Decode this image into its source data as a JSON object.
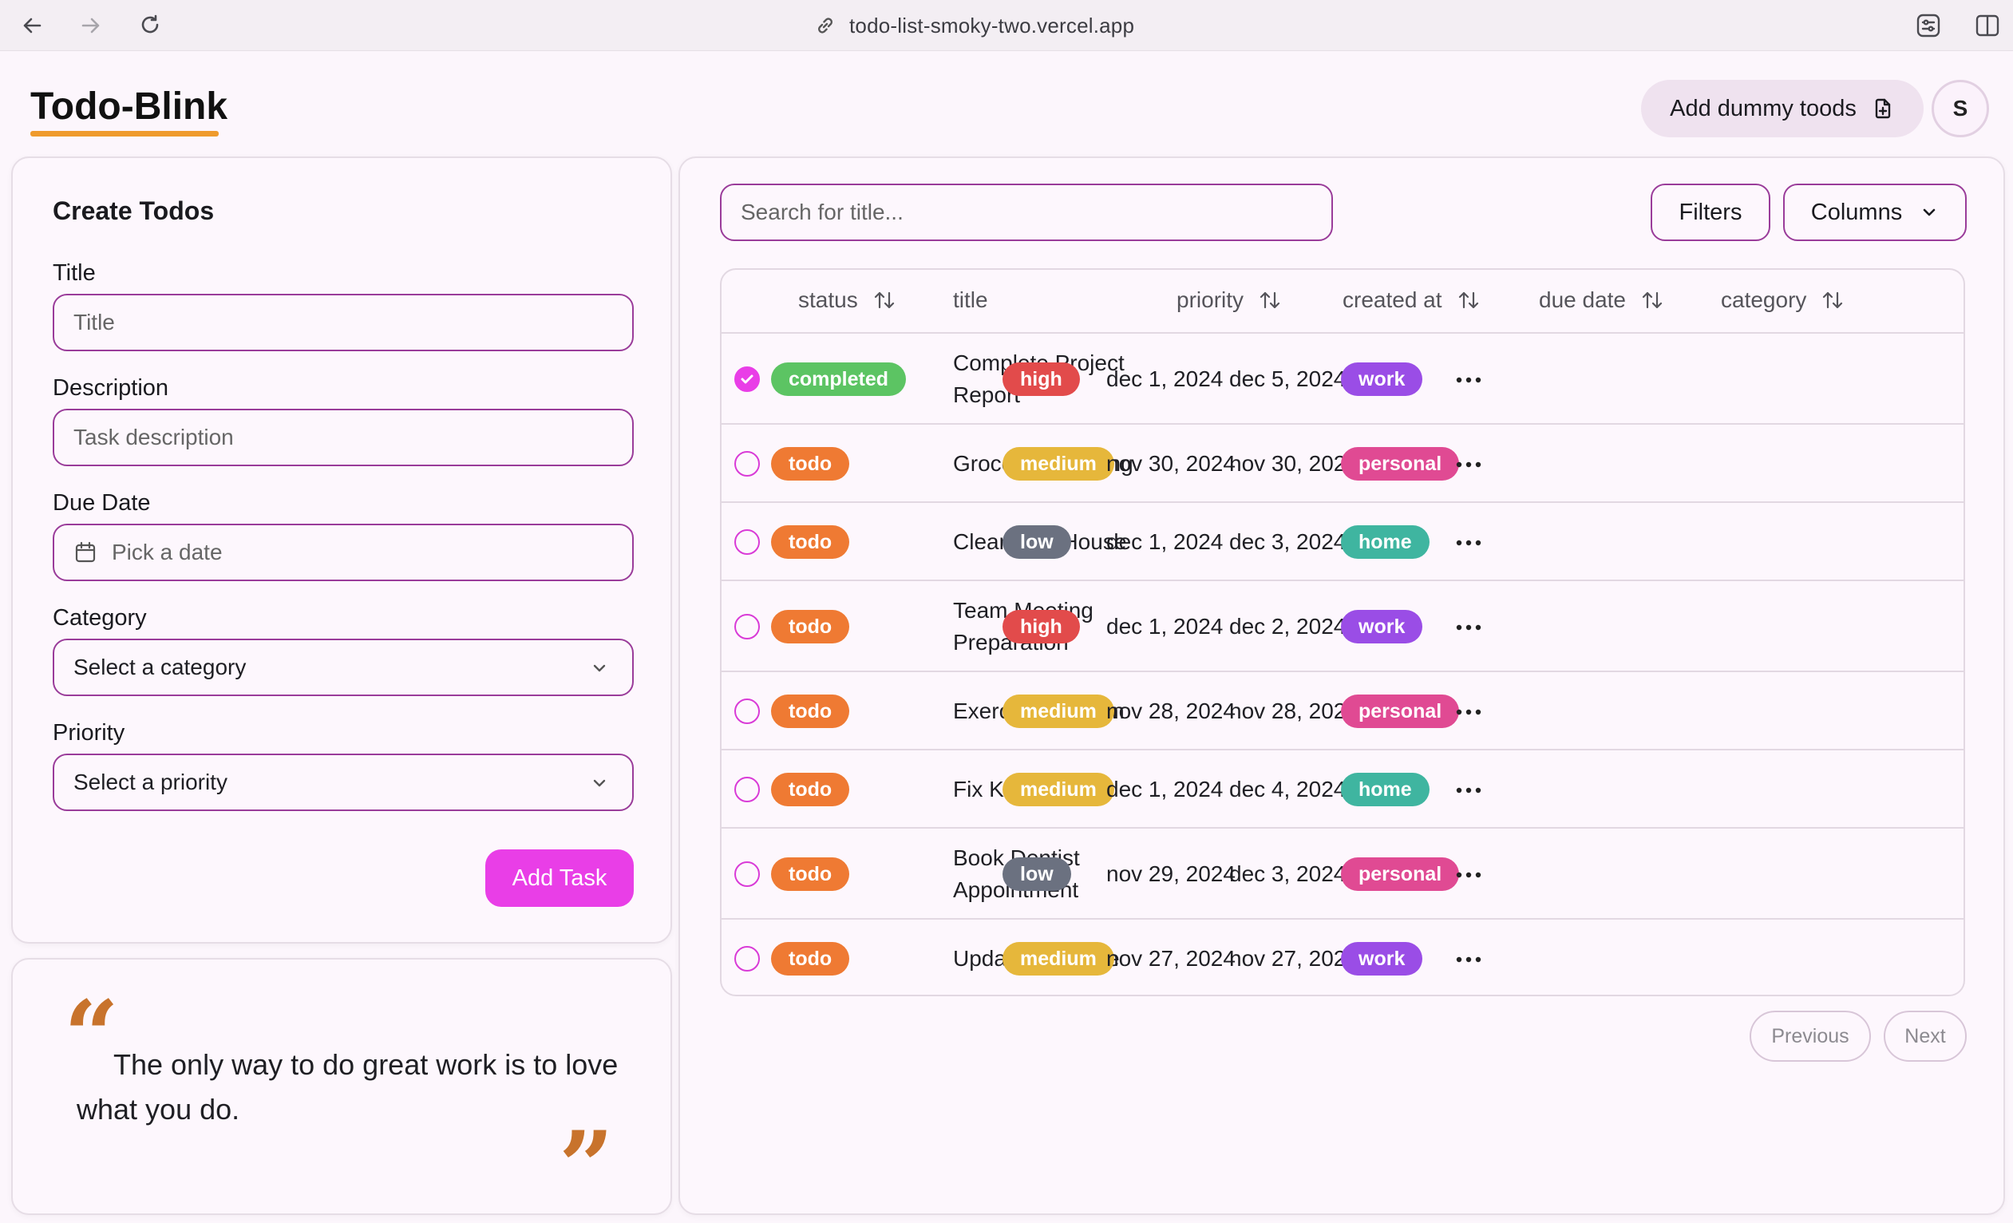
{
  "browser": {
    "url": "todo-list-smoky-two.vercel.app"
  },
  "header": {
    "app_title": "Todo-Blink",
    "dummy_button_label": "Add dummy toods",
    "avatar_initial": "S"
  },
  "create_form": {
    "heading": "Create Todos",
    "title_label": "Title",
    "title_placeholder": "Title",
    "description_label": "Description",
    "description_placeholder": "Task description",
    "due_date_label": "Due Date",
    "due_date_placeholder": "Pick a date",
    "category_label": "Category",
    "category_value": "Select a category",
    "priority_label": "Priority",
    "priority_value": "Select a priority",
    "submit_label": "Add Task"
  },
  "quote": {
    "text": "The only way to do great work is to love what you do."
  },
  "toolbar": {
    "search_placeholder": "Search for title...",
    "filters_label": "Filters",
    "columns_label": "Columns"
  },
  "table": {
    "headers": {
      "status": "status",
      "title": "title",
      "priority": "priority",
      "created_at": "created at",
      "due_date": "due date",
      "category": "category"
    },
    "rows": [
      {
        "checked": true,
        "status": "completed",
        "title": "Complete Project Report",
        "priority": "high",
        "created_at": "dec 1, 2024",
        "due_date": "dec 5, 2024",
        "category": "work"
      },
      {
        "checked": false,
        "status": "todo",
        "title": "Grocery Shopping",
        "priority": "medium",
        "created_at": "nov 30, 2024",
        "due_date": "nov 30, 2024",
        "category": "personal"
      },
      {
        "checked": false,
        "status": "todo",
        "title": "Clean The House",
        "priority": "low",
        "created_at": "dec 1, 2024",
        "due_date": "dec 3, 2024",
        "category": "home"
      },
      {
        "checked": false,
        "status": "todo",
        "title": "Team Meeting Preparation",
        "priority": "high",
        "created_at": "dec 1, 2024",
        "due_date": "dec 2, 2024",
        "category": "work"
      },
      {
        "checked": false,
        "status": "todo",
        "title": "Exercise Session",
        "priority": "medium",
        "created_at": "nov 28, 2024",
        "due_date": "nov 28, 2024",
        "category": "personal"
      },
      {
        "checked": false,
        "status": "todo",
        "title": "Fix Kitchen Sink",
        "priority": "medium",
        "created_at": "dec 1, 2024",
        "due_date": "dec 4, 2024",
        "category": "home"
      },
      {
        "checked": false,
        "status": "todo",
        "title": "Book Dentist Appointment",
        "priority": "low",
        "created_at": "nov 29, 2024",
        "due_date": "dec 3, 2024",
        "category": "personal"
      },
      {
        "checked": false,
        "status": "todo",
        "title": "Update Software",
        "priority": "medium",
        "created_at": "nov 27, 2024",
        "due_date": "nov 27, 2024",
        "category": "work"
      }
    ]
  },
  "pagination": {
    "previous_label": "Previous",
    "next_label": "Next"
  },
  "colors": {
    "accent": "#e93ee7",
    "title_underline": "#ef9b2c",
    "status_completed": "#5cc463",
    "status_todo": "#ef7a33",
    "priority_high": "#e24b4b",
    "priority_medium": "#e6b73b",
    "priority_low": "#6b7180",
    "category_work": "#9a4de6",
    "category_personal": "#e04a93",
    "category_home": "#3fb5a0"
  }
}
